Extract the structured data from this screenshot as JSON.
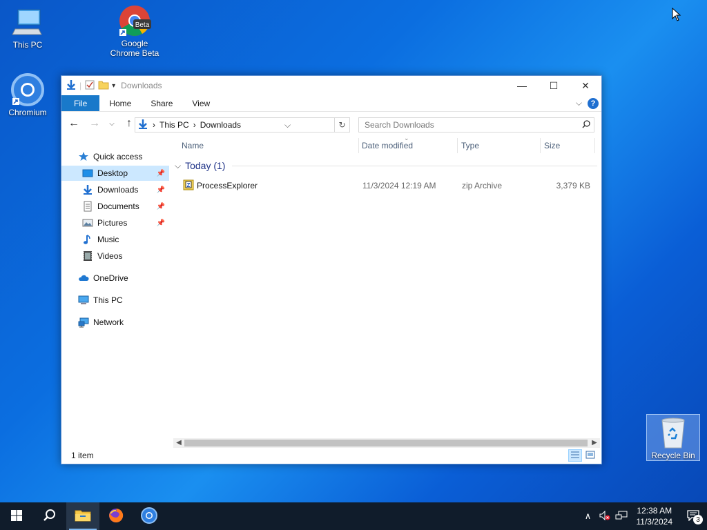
{
  "desktop": {
    "icons": [
      {
        "label": "This PC"
      },
      {
        "label": "Google Chrome Beta"
      },
      {
        "label": "Chromium"
      },
      {
        "label": "Recycle Bin"
      }
    ]
  },
  "window": {
    "title": "Downloads",
    "ribbon_tabs": [
      "File",
      "Home",
      "Share",
      "View"
    ],
    "address": {
      "segments": [
        "This PC",
        "Downloads"
      ]
    },
    "search": {
      "placeholder": "Search Downloads"
    },
    "nav": {
      "quick_access": "Quick access",
      "items": [
        "Desktop",
        "Downloads",
        "Documents",
        "Pictures",
        "Music",
        "Videos"
      ],
      "onedrive": "OneDrive",
      "this_pc": "This PC",
      "network": "Network"
    },
    "columns": {
      "name": "Name",
      "date": "Date modified",
      "type": "Type",
      "size": "Size"
    },
    "group_label": "Today (1)",
    "files": [
      {
        "name": "ProcessExplorer",
        "date": "11/3/2024 12:19 AM",
        "type": "zip Archive",
        "size": "3,379 KB"
      }
    ],
    "status": "1 item"
  },
  "taskbar": {
    "time": "12:38 AM",
    "date": "11/3/2024",
    "notification_count": "3"
  },
  "colors": {
    "accent": "#1979ca",
    "selection": "#cce8ff",
    "taskbar": "#101c2b"
  }
}
